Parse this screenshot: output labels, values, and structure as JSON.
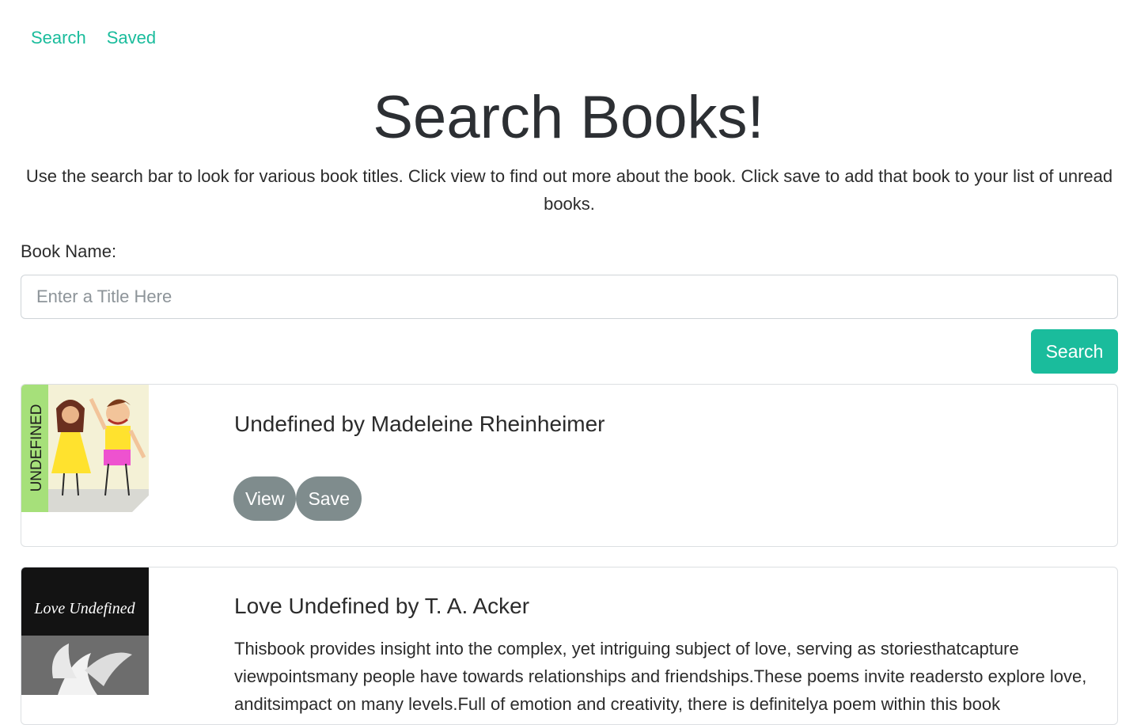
{
  "nav": {
    "search": "Search",
    "saved": "Saved"
  },
  "header": {
    "title": "Search Books!",
    "description": "Use the search bar to look for various book titles. Click view to find out more about the book. Click save to add that book to your list of unread books."
  },
  "search": {
    "label": "Book Name:",
    "placeholder": "Enter a Title Here",
    "value": "",
    "button": "Search"
  },
  "results": [
    {
      "title": "Undefined by Madeleine Rheinheimer",
      "cover_text": "UNDEFINED",
      "description": "",
      "view_label": "View",
      "save_label": "Save"
    },
    {
      "title": "Love Undefined by T. A. Acker",
      "cover_text": "Love Undefined",
      "description": "Thisbook provides insight into the complex, yet intriguing subject of love, serving as storiesthatcapture viewpointsmany people have towards relationships and friendships.These poems invite readersto explore love, anditsimpact on many levels.Full of emotion and creativity, there is definitelya poem within this book"
    }
  ],
  "colors": {
    "accent": "#1abc9c",
    "pill": "#7f8c8d"
  }
}
